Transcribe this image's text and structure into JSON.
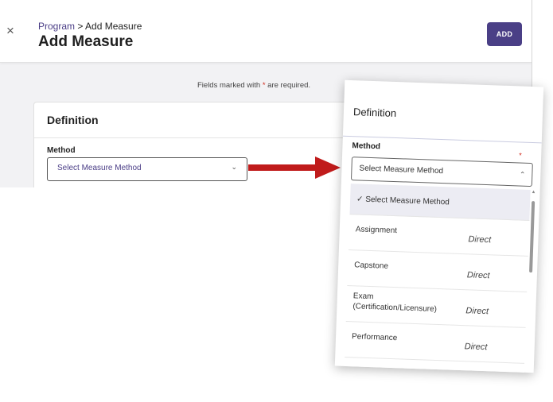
{
  "header": {
    "breadcrumb_link": "Program",
    "breadcrumb_sep": " > ",
    "breadcrumb_current": "Add Measure",
    "title": "Add Measure",
    "close_icon": "×",
    "add_label": "ADD"
  },
  "form": {
    "required_prefix": "Fields marked with ",
    "required_star": "*",
    "required_suffix": " are required.",
    "section_title": "Definition",
    "method_label": "Method",
    "method_value": "Select Measure Method",
    "chevron_down": "⌄"
  },
  "inset": {
    "section_title": "Definition",
    "method_label": "Method",
    "required_star": "*",
    "select_value": "Select Measure Method",
    "chevron_up": "⌃",
    "options": [
      {
        "label": "✓ Select Measure Method",
        "type": ""
      },
      {
        "label": "Assignment",
        "type": "Direct"
      },
      {
        "label": "Capstone",
        "type": "Direct"
      },
      {
        "label": "Exam (Certification/Licensure)",
        "type": "Direct"
      },
      {
        "label": "Performance",
        "type": "Direct"
      }
    ]
  },
  "colors": {
    "accent": "#4a3f86",
    "required": "#d0291b",
    "arrow": "#c01b1b"
  }
}
